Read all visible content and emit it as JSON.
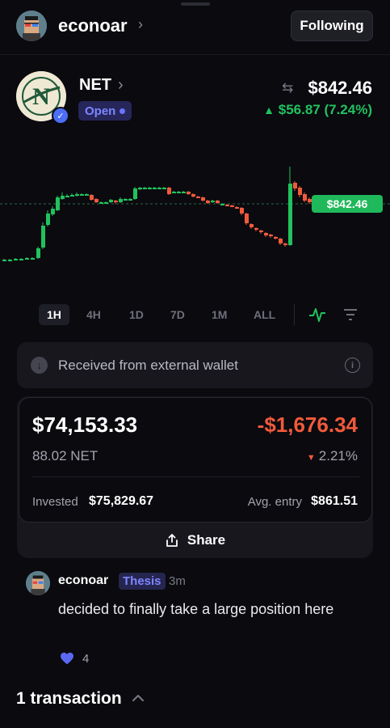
{
  "header": {
    "username": "econoar",
    "follow_label": "Following"
  },
  "asset": {
    "ticker": "NET",
    "status": "Open",
    "price": "$842.46",
    "change": "$56.87 (7.24%)",
    "logo_letter": "N"
  },
  "chart": {
    "price_tag": "$842.46",
    "up_color": "#21c25e",
    "down_color": "#f05a3b"
  },
  "chart_data": {
    "type": "candlestick",
    "current_price": 842.46,
    "candles": [
      {
        "o": 1,
        "c": 1,
        "h": 1,
        "l": 1
      },
      {
        "o": 1,
        "c": 1,
        "h": 1,
        "l": 1
      },
      {
        "o": 1,
        "c": 1,
        "h": 1,
        "l": 1
      },
      {
        "o": 1,
        "c": 1,
        "h": 1,
        "l": 1
      },
      {
        "o": 1,
        "c": 1,
        "h": 1,
        "l": 1
      },
      {
        "o": 1,
        "c": 1,
        "h": 1,
        "l": 1
      },
      {
        "o": 1,
        "c": 1,
        "h": 1,
        "l": 1
      },
      {
        "o": 1,
        "c": 1,
        "h": 1,
        "l": 1
      }
    ]
  },
  "timeframes": [
    "1H",
    "4H",
    "1D",
    "7D",
    "1M",
    "ALL"
  ],
  "active_timeframe": "1H",
  "banner": {
    "text": "Received from external wallet"
  },
  "position": {
    "value": "$74,153.33",
    "pnl": "-$1,676.34",
    "quantity": "88.02 NET",
    "pnl_pct": "2.21%",
    "invested_label": "Invested",
    "invested_value": "$75,829.67",
    "avg_label": "Avg. entry",
    "avg_value": "$861.51",
    "share_label": "Share"
  },
  "comment": {
    "user": "econoar",
    "tag": "Thesis",
    "time": "3m",
    "text": "decided to finally take a large position here",
    "likes": "4"
  },
  "transactions": {
    "title": "1 transaction"
  }
}
